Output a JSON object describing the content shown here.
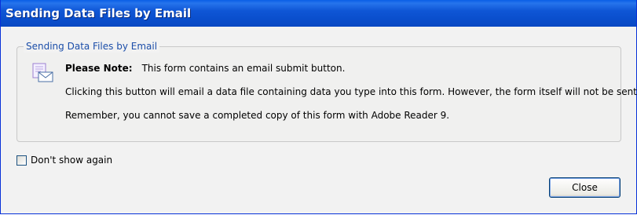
{
  "window": {
    "title": "Sending Data Files by Email"
  },
  "group": {
    "legend": "Sending Data Files by Email",
    "icon": "email-form-icon",
    "note_label": "Please Note:",
    "note_text": "This form contains an email submit button.",
    "line2": "Clicking this button will email a data file containing data you type into this form. However, the form itself will not be sent.",
    "line3": "Remember, you cannot save a completed copy of this form with Adobe Reader 9."
  },
  "checkbox": {
    "label": "Don't show again",
    "checked": false
  },
  "buttons": {
    "close_label": "Close"
  },
  "colors": {
    "titlebar": "#0a4fcd",
    "legend_text": "#1c4ea9"
  }
}
